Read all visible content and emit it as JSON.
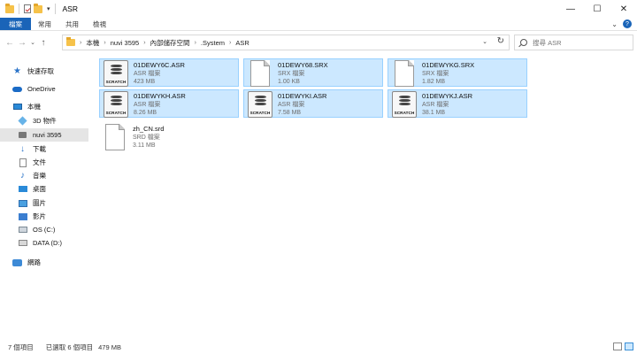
{
  "window": {
    "title": "ASR",
    "buttons": {
      "minimize": "—",
      "maximize": "☐",
      "close": "✕"
    }
  },
  "ribbon": {
    "tabs": [
      "檔案",
      "常用",
      "共用",
      "檢視"
    ],
    "collapse_glyph": "⌄",
    "help_glyph": "?"
  },
  "nav": {
    "back": "←",
    "forward": "→",
    "recent": "⌄",
    "up": "↑"
  },
  "address": {
    "crumbs": [
      "本機",
      "nuvi 3595",
      "內部儲存空間",
      ".System",
      "ASR"
    ],
    "separator": "›",
    "dropdown": "⌄",
    "refresh": "↻"
  },
  "search": {
    "placeholder": "搜尋 ASR"
  },
  "sidebar": {
    "items": [
      {
        "label": "快速存取",
        "icon": "star-icon"
      },
      {
        "label": "OneDrive",
        "icon": "cloud-icon"
      },
      {
        "label": "本機",
        "icon": "computer-icon"
      },
      {
        "label": "3D 物件",
        "icon": "cube-icon"
      },
      {
        "label": "nuvi 3595",
        "icon": "device-icon",
        "selected": true
      },
      {
        "label": "下載",
        "icon": "download-icon"
      },
      {
        "label": "文件",
        "icon": "document-icon"
      },
      {
        "label": "音樂",
        "icon": "music-icon"
      },
      {
        "label": "桌面",
        "icon": "desktop-icon"
      },
      {
        "label": "圖片",
        "icon": "picture-icon"
      },
      {
        "label": "影片",
        "icon": "video-icon"
      },
      {
        "label": "OS (C:)",
        "icon": "drive-icon"
      },
      {
        "label": "DATA (D:)",
        "icon": "drive-icon"
      },
      {
        "label": "網路",
        "icon": "network-icon"
      }
    ]
  },
  "files": [
    {
      "name": "01DEWY6C.ASR",
      "type": "ASR 檔案",
      "size": "423 MB",
      "icon": "scratch-disk-icon",
      "icon_label": "SCRATCH",
      "selected": true
    },
    {
      "name": "01DEWY68.SRX",
      "type": "SRX 檔案",
      "size": "1.00 KB",
      "icon": "blank-file-icon",
      "selected": true
    },
    {
      "name": "01DEWYKG.SRX",
      "type": "SRX 檔案",
      "size": "1.82 MB",
      "icon": "blank-file-icon",
      "selected": true
    },
    {
      "name": "01DEWYKH.ASR",
      "type": "ASR 檔案",
      "size": "8.26 MB",
      "icon": "scratch-disk-icon",
      "icon_label": "SCRATCH",
      "selected": true
    },
    {
      "name": "01DEWYKI.ASR",
      "type": "ASR 檔案",
      "size": "7.58 MB",
      "icon": "scratch-disk-icon",
      "icon_label": "SCRATCH",
      "selected": true
    },
    {
      "name": "01DEWYKJ.ASR",
      "type": "ASR 檔案",
      "size": "38.1 MB",
      "icon": "scratch-disk-icon",
      "icon_label": "SCRATCH",
      "selected": true
    },
    {
      "name": "zh_CN.srd",
      "type": "SRD 檔案",
      "size": "3.11 MB",
      "icon": "blank-file-icon",
      "selected": false
    }
  ],
  "status": {
    "count": "7 個項目",
    "selected": "已選取 6 個項目",
    "size": "479 MB"
  },
  "colors": {
    "accent": "#1a64b8",
    "selection_fill": "#cce8ff",
    "selection_border": "#99d1ff"
  }
}
